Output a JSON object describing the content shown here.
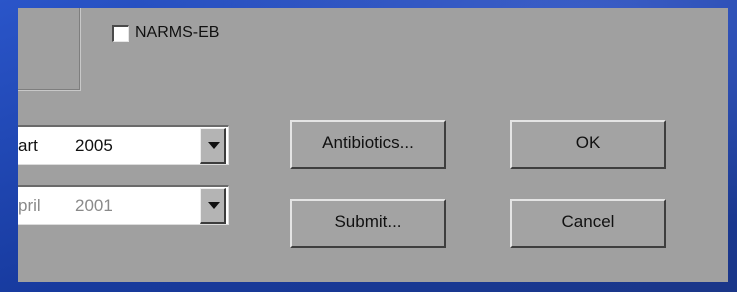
{
  "window": {
    "checkbox": {
      "label": "NARMS-EB",
      "checked": false
    }
  },
  "fields": {
    "current": {
      "month_partial": "art",
      "year": "2005"
    },
    "previous": {
      "month_partial": "pril",
      "year": "2001"
    }
  },
  "buttons": {
    "antibiotics": "Antibiotics...",
    "submit": "Submit...",
    "ok": "OK",
    "cancel": "Cancel"
  },
  "colors": {
    "dialog_bg": "#a0a0a0",
    "desktop_bg": "#1c3fa8",
    "field_bg": "#ffffff",
    "disabled_text": "#8a8a8a"
  }
}
